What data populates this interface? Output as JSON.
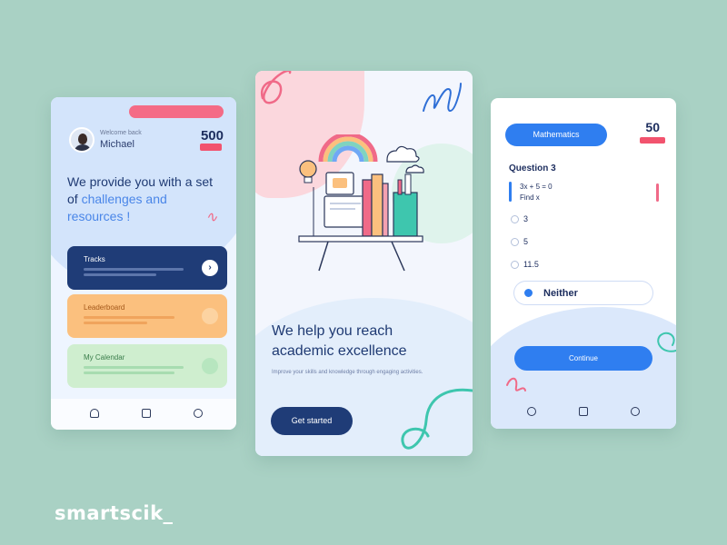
{
  "brand": "smartscik_",
  "screen1": {
    "welcome": "Welcome back",
    "user_name": "Michael",
    "score": "500",
    "heading_plain": "We provide you with a set of ",
    "heading_highlight": "challenges and resources !",
    "cards": [
      {
        "title": "Tracks",
        "action_icon": "chevron-right-icon"
      },
      {
        "title": "Leaderboard",
        "action_icon": "circle-icon"
      },
      {
        "title": "My Calendar",
        "action_icon": "circle-icon"
      }
    ],
    "nav_icons": [
      "home-icon",
      "folder-icon",
      "profile-icon"
    ]
  },
  "screen2": {
    "heading": "We help you reach academic excellence",
    "subtitle": "Improve your skills and knowledge through engaging activities.",
    "cta_label": "Get started"
  },
  "screen3": {
    "subject": "Mathematics",
    "score": "50",
    "question_number": "Question 3",
    "question_line1": "3x + 5 = 0",
    "question_line2": "Find x",
    "options": [
      "3",
      "5",
      "11.5",
      "Neither"
    ],
    "selected_option": "Neither",
    "continue_label": "Continue",
    "nav_icons": [
      "home-icon",
      "folder-icon",
      "profile-icon"
    ]
  },
  "colors": {
    "background": "#a9d1c4",
    "navy": "#1f3c77",
    "accent_blue": "#2f7ef0",
    "pink": "#f46b86",
    "orange": "#fbc07e",
    "green": "#cfeecf"
  }
}
